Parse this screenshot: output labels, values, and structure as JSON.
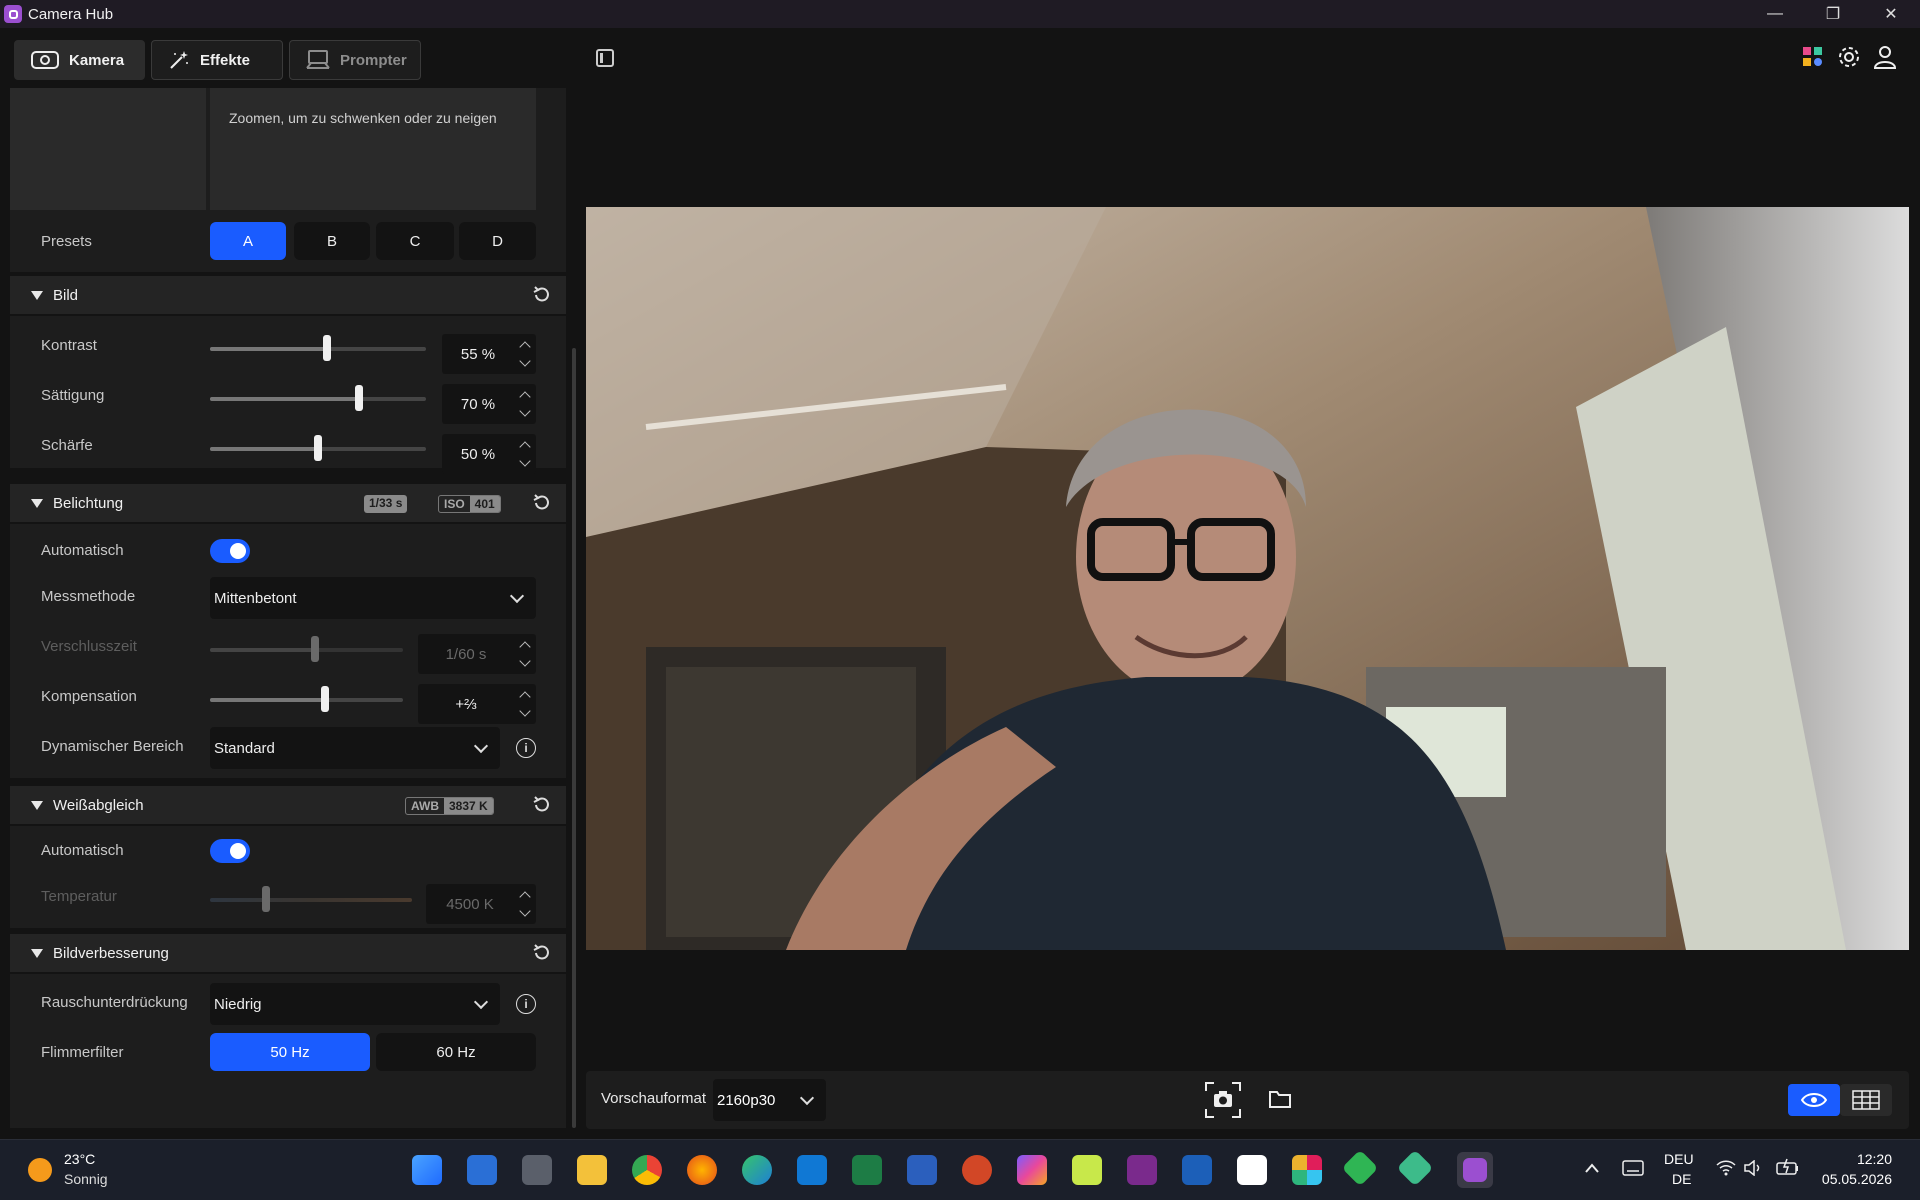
{
  "window": {
    "title": "Camera Hub"
  },
  "tabs": [
    {
      "label": "Kamera"
    },
    {
      "label": "Effekte"
    },
    {
      "label": "Prompter"
    }
  ],
  "top_panel": {
    "hint": "Zoomen, um zu schwenken oder zu neigen",
    "presets_label": "Presets",
    "presets": [
      "A",
      "B",
      "C",
      "D"
    ],
    "presets_selected": "A"
  },
  "bild": {
    "title": "Bild",
    "rows": [
      {
        "label": "Kontrast",
        "value": "55 %",
        "level": 0.55
      },
      {
        "label": "Sättigung",
        "value": "70 %",
        "level": 0.7
      },
      {
        "label": "Schärfe",
        "value": "50 %",
        "level": 0.5
      }
    ]
  },
  "belichtung": {
    "title": "Belichtung",
    "badge_shutter": "1/33 s",
    "badge_iso_label": "ISO",
    "badge_iso_value": "401",
    "auto_label": "Automatisch",
    "auto_on": true,
    "metering_label": "Messmethode",
    "metering_value": "Mittenbetont",
    "shutter_label": "Verschlusszeit",
    "shutter_value": "1/60 s",
    "comp_label": "Kompensation",
    "comp_value": "+⅔",
    "dr_label": "Dynamischer Bereich",
    "dr_value": "Standard"
  },
  "weissabgleich": {
    "title": "Weißabgleich",
    "badge_label": "AWB",
    "badge_value": "3837 K",
    "auto_label": "Automatisch",
    "auto_on": true,
    "temp_label": "Temperatur",
    "temp_value": "4500 K"
  },
  "bildverbesserung": {
    "title": "Bildverbesserung",
    "noise_label": "Rauschunterdrückung",
    "noise_value": "Niedrig",
    "flicker_label": "Flimmerfilter",
    "flicker_options": [
      "50 Hz",
      "60 Hz"
    ],
    "flicker_selected": "50 Hz"
  },
  "bottom_bar": {
    "format_label": "Vorschauformat",
    "format_value": "2160p30"
  },
  "taskbar": {
    "weather_temp": "23°C",
    "weather_desc": "Sonnig",
    "lang_top": "DEU",
    "lang_bottom": "DE",
    "time": "12:20",
    "date": "05.05.2026"
  },
  "colors": {
    "accent": "#1a5cff",
    "app_icon": "#9b4fd0"
  }
}
